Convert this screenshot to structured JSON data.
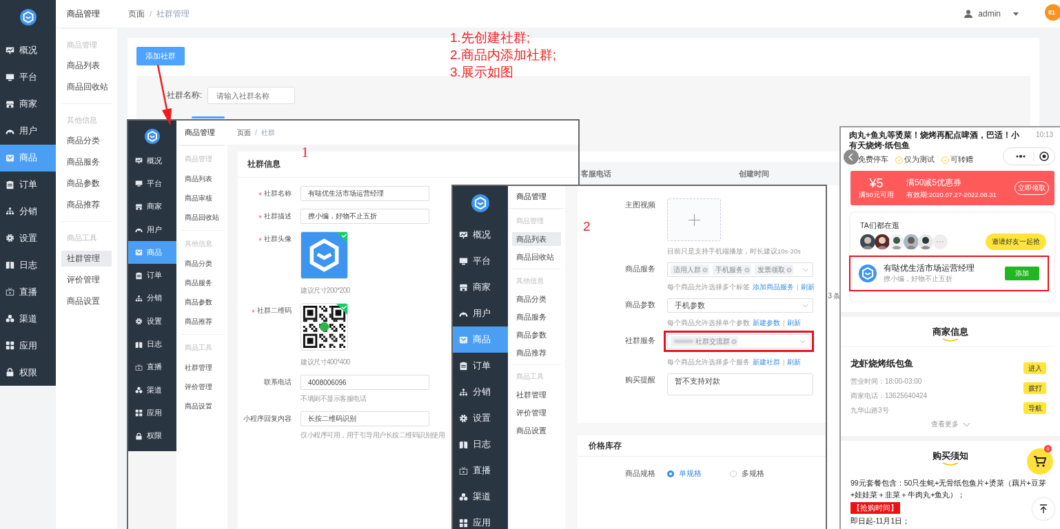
{
  "base": {
    "nav": [
      {
        "label": "概况",
        "kind": "presentation",
        "selected": false
      },
      {
        "label": "平台",
        "kind": "monitor",
        "selected": false
      },
      {
        "label": "商家",
        "kind": "store",
        "selected": false
      },
      {
        "label": "用户",
        "kind": "user",
        "selected": false
      },
      {
        "label": "商品",
        "kind": "bag",
        "selected": true
      },
      {
        "label": "订单",
        "kind": "clipboard",
        "selected": false
      },
      {
        "label": "分销",
        "kind": "hierarchy",
        "selected": false
      },
      {
        "label": "设置",
        "kind": "gear",
        "selected": false
      },
      {
        "label": "日志",
        "kind": "book",
        "selected": false
      },
      {
        "label": "直播",
        "kind": "tv",
        "selected": false
      },
      {
        "label": "渠道",
        "kind": "cluster",
        "selected": false
      },
      {
        "label": "应用",
        "kind": "grid",
        "selected": false
      },
      {
        "label": "权限",
        "kind": "lock",
        "selected": false
      }
    ],
    "subnav": {
      "title": "商品管理",
      "groups": [
        {
          "heading": "商品管理",
          "items": [
            {
              "label": "商品列表",
              "selected": false
            },
            {
              "label": "商品回收站",
              "selected": false
            }
          ]
        },
        {
          "heading": "其他信息",
          "items": [
            {
              "label": "商品分类",
              "selected": false
            },
            {
              "label": "商品服务",
              "selected": false
            },
            {
              "label": "商品参数",
              "selected": false
            },
            {
              "label": "商品推荐",
              "selected": false
            }
          ]
        },
        {
          "heading": "商品工具",
          "items": [
            {
              "label": "社群管理",
              "selected": true
            },
            {
              "label": "评价管理",
              "selected": false
            },
            {
              "label": "商品设置",
              "selected": false
            }
          ]
        }
      ]
    },
    "breadcrumb": [
      "页面",
      "社群管理"
    ],
    "separator": "/",
    "user": "admin",
    "notification_count": "81",
    "add_button": "添加社群",
    "filter": {
      "label": "社群名称:",
      "placeholder": "请输入社群名称"
    },
    "table": {
      "columns": [
        "客服电话",
        "创建时间"
      ],
      "total": "3 条"
    }
  },
  "annotation": {
    "steps": [
      "1.先创建社群;",
      "2.商品内添加社群;",
      "3.展示如图"
    ],
    "markers": [
      "1",
      "2"
    ]
  },
  "shot1": {
    "nav": [
      {
        "label": "概况",
        "kind": "presentation",
        "selected": false
      },
      {
        "label": "平台",
        "kind": "monitor",
        "selected": false
      },
      {
        "label": "商家",
        "kind": "store",
        "selected": false
      },
      {
        "label": "用户",
        "kind": "user",
        "selected": false
      },
      {
        "label": "商品",
        "kind": "bag",
        "selected": true
      },
      {
        "label": "订单",
        "kind": "clipboard",
        "selected": false
      },
      {
        "label": "分销",
        "kind": "hierarchy",
        "selected": false
      },
      {
        "label": "设置",
        "kind": "gear",
        "selected": false
      },
      {
        "label": "日志",
        "kind": "book",
        "selected": false
      },
      {
        "label": "直播",
        "kind": "tv",
        "selected": false
      },
      {
        "label": "渠道",
        "kind": "cluster",
        "selected": false
      },
      {
        "label": "应用",
        "kind": "grid",
        "selected": false
      },
      {
        "label": "权限",
        "kind": "lock",
        "selected": false
      }
    ],
    "subnav": {
      "title": "商品管理",
      "groups": [
        {
          "heading": "商品管理",
          "items": [
            {
              "label": "商品列表",
              "selected": false
            },
            {
              "label": "商品审核",
              "selected": false
            },
            {
              "label": "商品回收站",
              "selected": false
            }
          ]
        },
        {
          "heading": "其他信息",
          "items": [
            {
              "label": "商品分类",
              "selected": false
            },
            {
              "label": "商品服务",
              "selected": false
            },
            {
              "label": "商品参数",
              "selected": false
            },
            {
              "label": "商品推荐",
              "selected": false
            }
          ]
        },
        {
          "heading": "商品工具",
          "items": [
            {
              "label": "社群管理",
              "selected": false
            },
            {
              "label": "评价管理",
              "selected": false
            },
            {
              "label": "商品设置",
              "selected": false
            }
          ]
        }
      ]
    },
    "breadcrumb": [
      "页面",
      "社群"
    ],
    "separator": "/",
    "card_title": "社群信息",
    "fields": [
      {
        "kind": "input",
        "label": "社群名称",
        "required": true,
        "value": "有哒优生活市场运营经理"
      },
      {
        "kind": "input",
        "label": "社群描述",
        "required": true,
        "value": "撩小编，好物不止五折"
      },
      {
        "kind": "logo_image",
        "label": "社群头像",
        "required": true,
        "uploaded": true,
        "hint": "建议尺寸200*200"
      },
      {
        "kind": "qr_image",
        "label": "社群二维码",
        "required": true,
        "uploaded": true,
        "hint": "建议尺寸400*400"
      },
      {
        "kind": "input",
        "label": "联系电话",
        "required": false,
        "value": "4008006096",
        "hint": "不填则不显示客服电话"
      },
      {
        "kind": "input",
        "label": "小程序回复内容",
        "required": false,
        "value": "长按二维码识别",
        "hint": "仅小程序可用，用于引导用户长按二维码识别使用"
      }
    ]
  },
  "shot2": {
    "nav": [
      {
        "label": "概况",
        "kind": "presentation",
        "selected": false
      },
      {
        "label": "平台",
        "kind": "monitor",
        "selected": false
      },
      {
        "label": "商家",
        "kind": "store",
        "selected": false
      },
      {
        "label": "用户",
        "kind": "user",
        "selected": false
      },
      {
        "label": "商品",
        "kind": "bag",
        "selected": true
      },
      {
        "label": "订单",
        "kind": "clipboard",
        "selected": false
      },
      {
        "label": "分销",
        "kind": "hierarchy",
        "selected": false
      },
      {
        "label": "设置",
        "kind": "gear",
        "selected": false
      },
      {
        "label": "日志",
        "kind": "book",
        "selected": false
      },
      {
        "label": "直播",
        "kind": "tv",
        "selected": false
      },
      {
        "label": "渠道",
        "kind": "cluster",
        "selected": false
      },
      {
        "label": "应用",
        "kind": "grid",
        "selected": false
      }
    ],
    "subnav": {
      "title": "商品管理",
      "groups": [
        {
          "heading": "商品管理",
          "items": [
            {
              "label": "商品列表",
              "selected": true
            },
            {
              "label": "商品回收站",
              "selected": false
            }
          ]
        },
        {
          "heading": "其他信息",
          "items": [
            {
              "label": "商品分类",
              "selected": false
            },
            {
              "label": "商品服务",
              "selected": false
            },
            {
              "label": "商品参数",
              "selected": false
            },
            {
              "label": "商品推荐",
              "selected": false
            }
          ]
        },
        {
          "heading": "商品工具",
          "items": [
            {
              "label": "社群管理",
              "selected": false
            },
            {
              "label": "评价管理",
              "selected": false
            },
            {
              "label": "商品设置",
              "selected": false
            }
          ]
        }
      ]
    },
    "link_separator": "|",
    "fields": [
      {
        "kind": "upload",
        "label": "主图视频",
        "hint": "目前只是支持手机端播放，时长建议10s-20s"
      },
      {
        "kind": "tags",
        "label": "商品服务",
        "tags": [
          "适用人群",
          "手机服务",
          "发票领取"
        ],
        "hint": "每个商品允许选择多个标签",
        "links": [
          "添加商品服务",
          "刷新"
        ],
        "highlighted": false,
        "blurred": false
      },
      {
        "kind": "select",
        "label": "商品参数",
        "value": "手机参数",
        "hint": "每个商品允许选择单个参数",
        "links": [
          "新建参数",
          "刷新"
        ]
      },
      {
        "kind": "tags",
        "label": "社群服务",
        "tags": [
          "社群交流群"
        ],
        "hint": "每个商品允许选择多个服务",
        "links": [
          "新建社群",
          "刷新"
        ],
        "highlighted": true,
        "blurred": true
      },
      {
        "kind": "textarea",
        "label": "购买提醒",
        "value": "暂不支持对款"
      }
    ],
    "price": {
      "title": "价格库存",
      "label": "商品规格",
      "options": [
        {
          "label": "单规格",
          "selected": true
        },
        {
          "label": "多规格",
          "selected": false
        }
      ]
    }
  },
  "phone": {
    "time": "10:13",
    "title_lines": [
      "肉丸+鱼丸等烫菜！烧烤再配点啤酒，巴适！小",
      "有天烧烤·纸包鱼"
    ],
    "features": [
      "免费停车",
      "仅为测试",
      "可转赠"
    ],
    "coupon": {
      "amount": "¥5",
      "condition": "满50元可用",
      "name": "满50减5优惠券",
      "validity": "有效期:2020.07.27-2022.08.31",
      "button": "立即领取"
    },
    "browsing": {
      "title": "TA们都在逛",
      "avatars": [
        {
          "kind": "picture"
        },
        {
          "kind": "picture"
        },
        {
          "kind": "picture"
        },
        {
          "kind": "picture"
        },
        {
          "kind": "picture"
        },
        {
          "kind": "more"
        }
      ],
      "button": "邀请好友一起抢"
    },
    "community": {
      "name": "有哒优生活市场运营经理",
      "description": "撩小编，好物不止五折",
      "button": "添加",
      "highlighted": true
    },
    "merchant": {
      "heading": "商家信息",
      "name": "龙虾烧烤纸包鱼",
      "lines": [
        "营业时间：18:00-03:00",
        "商家电话：13625640424",
        "九华山路3号"
      ],
      "buttons": [
        "进入",
        "拨打",
        "导航"
      ],
      "more": "查看更多"
    },
    "notice": {
      "heading": "购买须知",
      "paragraphs": [
        {
          "kind": "text",
          "text": "99元套餐包含：50只生蚝+无骨纸包鱼片+烫菜（藕片+豆芽+娃娃菜＋韭菜＋牛肉丸+鱼丸）；"
        },
        {
          "kind": "tag",
          "text": "【抢购时间】"
        },
        {
          "kind": "text",
          "text": "即日起-11月1日；"
        }
      ]
    },
    "cart_count": "0"
  }
}
